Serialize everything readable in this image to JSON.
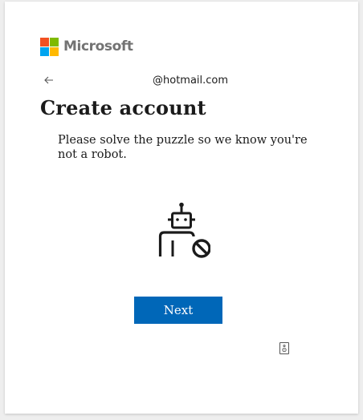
{
  "brand": {
    "name": "Microsoft",
    "colors": [
      "#f25022",
      "#7fba00",
      "#00a4ef",
      "#ffb900"
    ]
  },
  "identity": {
    "back_icon": "arrow-left-icon",
    "email_visible": "@hotmail.com"
  },
  "page": {
    "title": "Create account",
    "instructions": "Please solve the puzzle so we know you're not a robot."
  },
  "puzzle": {
    "icon": "robot-blocked-icon",
    "audio_icon": "speaker-icon"
  },
  "actions": {
    "next_label": "Next",
    "accent_color": "#0067b8"
  }
}
